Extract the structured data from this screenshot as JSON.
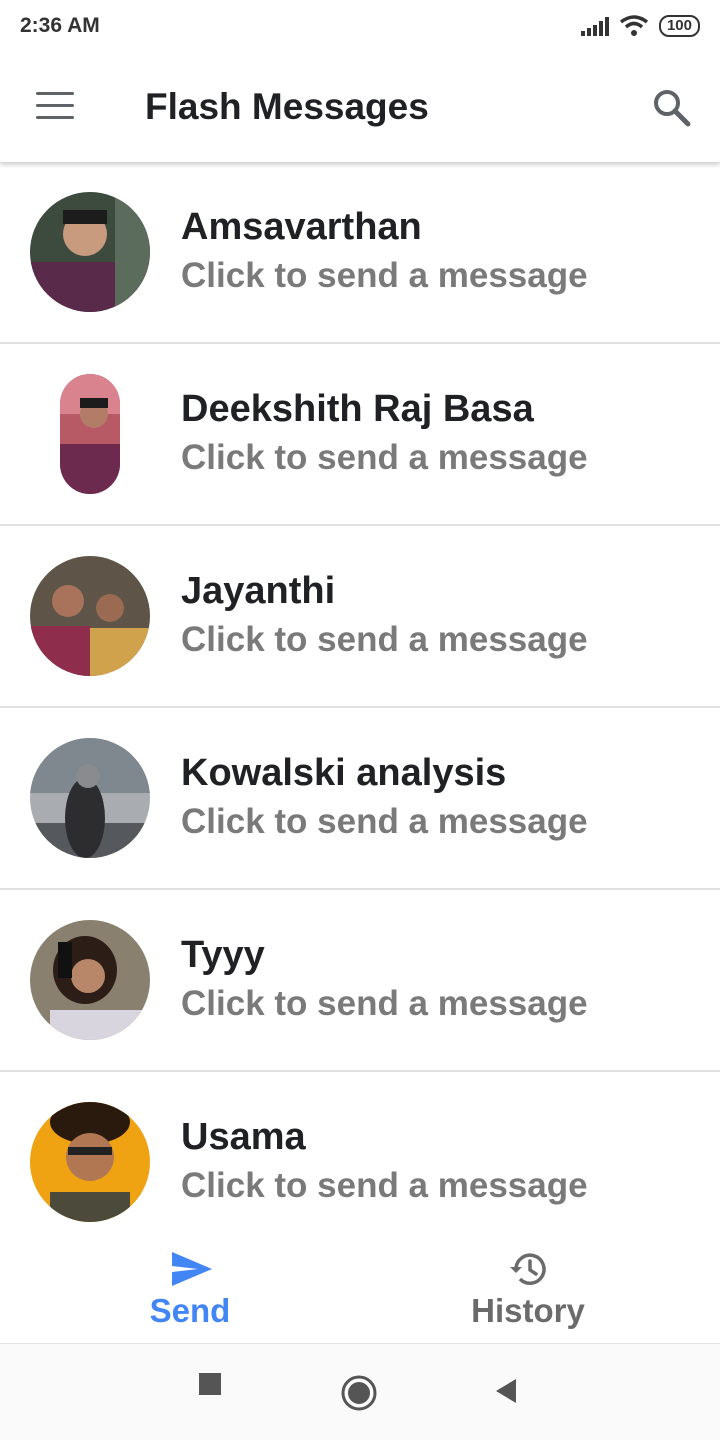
{
  "status_bar": {
    "time": "2:36 AM",
    "battery": "100"
  },
  "app_bar": {
    "title": "Flash Messages"
  },
  "contacts": [
    {
      "name": "Amsavarthan",
      "subtitle": "Click to send a message"
    },
    {
      "name": "Deekshith Raj Basa",
      "subtitle": "Click to send a message"
    },
    {
      "name": "Jayanthi",
      "subtitle": "Click to send a message"
    },
    {
      "name": "Kowalski analysis",
      "subtitle": "Click to send a message"
    },
    {
      "name": "Tyyy",
      "subtitle": "Click to send a message"
    },
    {
      "name": "Usama",
      "subtitle": "Click to send a message"
    }
  ],
  "bottom_nav": {
    "items": [
      {
        "label": "Send",
        "icon": "send-icon",
        "active": true
      },
      {
        "label": "History",
        "icon": "history-icon",
        "active": false
      }
    ]
  },
  "colors": {
    "accent": "#4285f4",
    "inactive": "#6b6b6b",
    "subtitle": "#7a7a7a"
  }
}
